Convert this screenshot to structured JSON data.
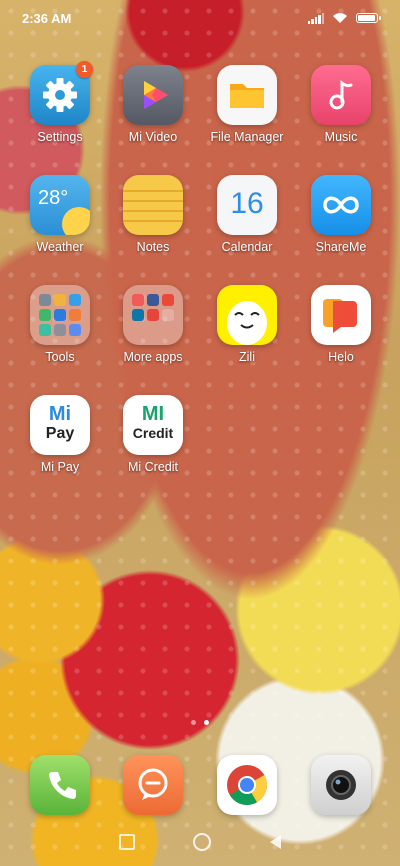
{
  "status": {
    "time": "2:36 AM",
    "battery_level": 0.85
  },
  "apps": [
    {
      "id": "settings",
      "label": "Settings",
      "icon": "gear-icon",
      "badge": "1"
    },
    {
      "id": "mi-video",
      "label": "Mi Video",
      "icon": "play-icon"
    },
    {
      "id": "file-manager",
      "label": "File Manager",
      "icon": "folder-icon"
    },
    {
      "id": "music",
      "label": "Music",
      "icon": "music-note-icon"
    },
    {
      "id": "weather",
      "label": "Weather",
      "icon": "weather-icon",
      "temp": "28°"
    },
    {
      "id": "notes",
      "label": "Notes",
      "icon": "notes-icon"
    },
    {
      "id": "calendar",
      "label": "Calendar",
      "icon": "calendar-icon",
      "day": "16"
    },
    {
      "id": "shareme",
      "label": "ShareMe",
      "icon": "infinity-icon"
    },
    {
      "id": "tools",
      "label": "Tools",
      "icon": "folder-grid-icon"
    },
    {
      "id": "more-apps",
      "label": "More apps",
      "icon": "folder-grid-icon"
    },
    {
      "id": "zili",
      "label": "Zili",
      "icon": "zili-face-icon"
    },
    {
      "id": "helo",
      "label": "Helo",
      "icon": "helo-icon"
    },
    {
      "id": "mi-pay",
      "label": "Mi Pay",
      "icon": "mi-pay-icon",
      "line1": "Mi",
      "line2": "Pay"
    },
    {
      "id": "mi-credit",
      "label": "Mi Credit",
      "icon": "mi-credit-icon",
      "line1": "MI",
      "line2": "Credit"
    }
  ],
  "dock": [
    {
      "id": "phone",
      "icon": "phone-icon"
    },
    {
      "id": "messages",
      "icon": "message-icon"
    },
    {
      "id": "chrome",
      "icon": "chrome-icon"
    },
    {
      "id": "camera",
      "icon": "camera-icon"
    }
  ],
  "colors": {
    "settings": "#2f9bd6",
    "mivideo": "#6b6f78",
    "files": "#f7f7f7",
    "music": "#f2547a",
    "weather": "#3fa3e0",
    "notes": "#f7c948",
    "calendar": "#f4f6f8",
    "shareme": "#22a0f0",
    "helo": "#ef5a35",
    "phone": "#7cc84a",
    "messages": "#f07a45"
  }
}
